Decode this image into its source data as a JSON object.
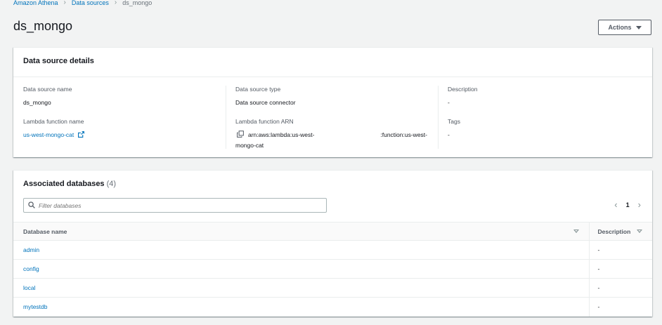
{
  "breadcrumb": {
    "items": [
      "Amazon Athena",
      "Data sources",
      "ds_mongo"
    ]
  },
  "page": {
    "title": "ds_mongo",
    "actions_label": "Actions"
  },
  "details": {
    "header": "Data source details",
    "source_name_label": "Data source name",
    "source_name_value": "ds_mongo",
    "lambda_name_label": "Lambda function name",
    "lambda_name_value": "us-west-mongo-cat",
    "source_type_label": "Data source type",
    "source_type_value": "Data source connector",
    "lambda_arn_label": "Lambda function ARN",
    "lambda_arn_part1": "arn:aws:lambda:us-west-",
    "lambda_arn_part2": ":function:us-west-",
    "lambda_arn_part3": "mongo-cat",
    "description_label": "Description",
    "description_value": "-",
    "tags_label": "Tags",
    "tags_value": "-"
  },
  "databases": {
    "title": "Associated databases",
    "count": "(4)",
    "filter_placeholder": "Filter databases",
    "page_number": "1",
    "columns": [
      "Database name",
      "Description"
    ],
    "rows": [
      {
        "name": "admin",
        "description": "-"
      },
      {
        "name": "config",
        "description": "-"
      },
      {
        "name": "local",
        "description": "-"
      },
      {
        "name": "mytestdb",
        "description": "-"
      }
    ]
  },
  "icons": {
    "breadcrumb_separator": "chevron-right-icon",
    "external_link": "external-link-icon",
    "copy": "copy-icon",
    "search": "search-icon"
  },
  "colors": {
    "link": "#0073bb",
    "background": "#f2f3f3",
    "text": "#16191f"
  }
}
